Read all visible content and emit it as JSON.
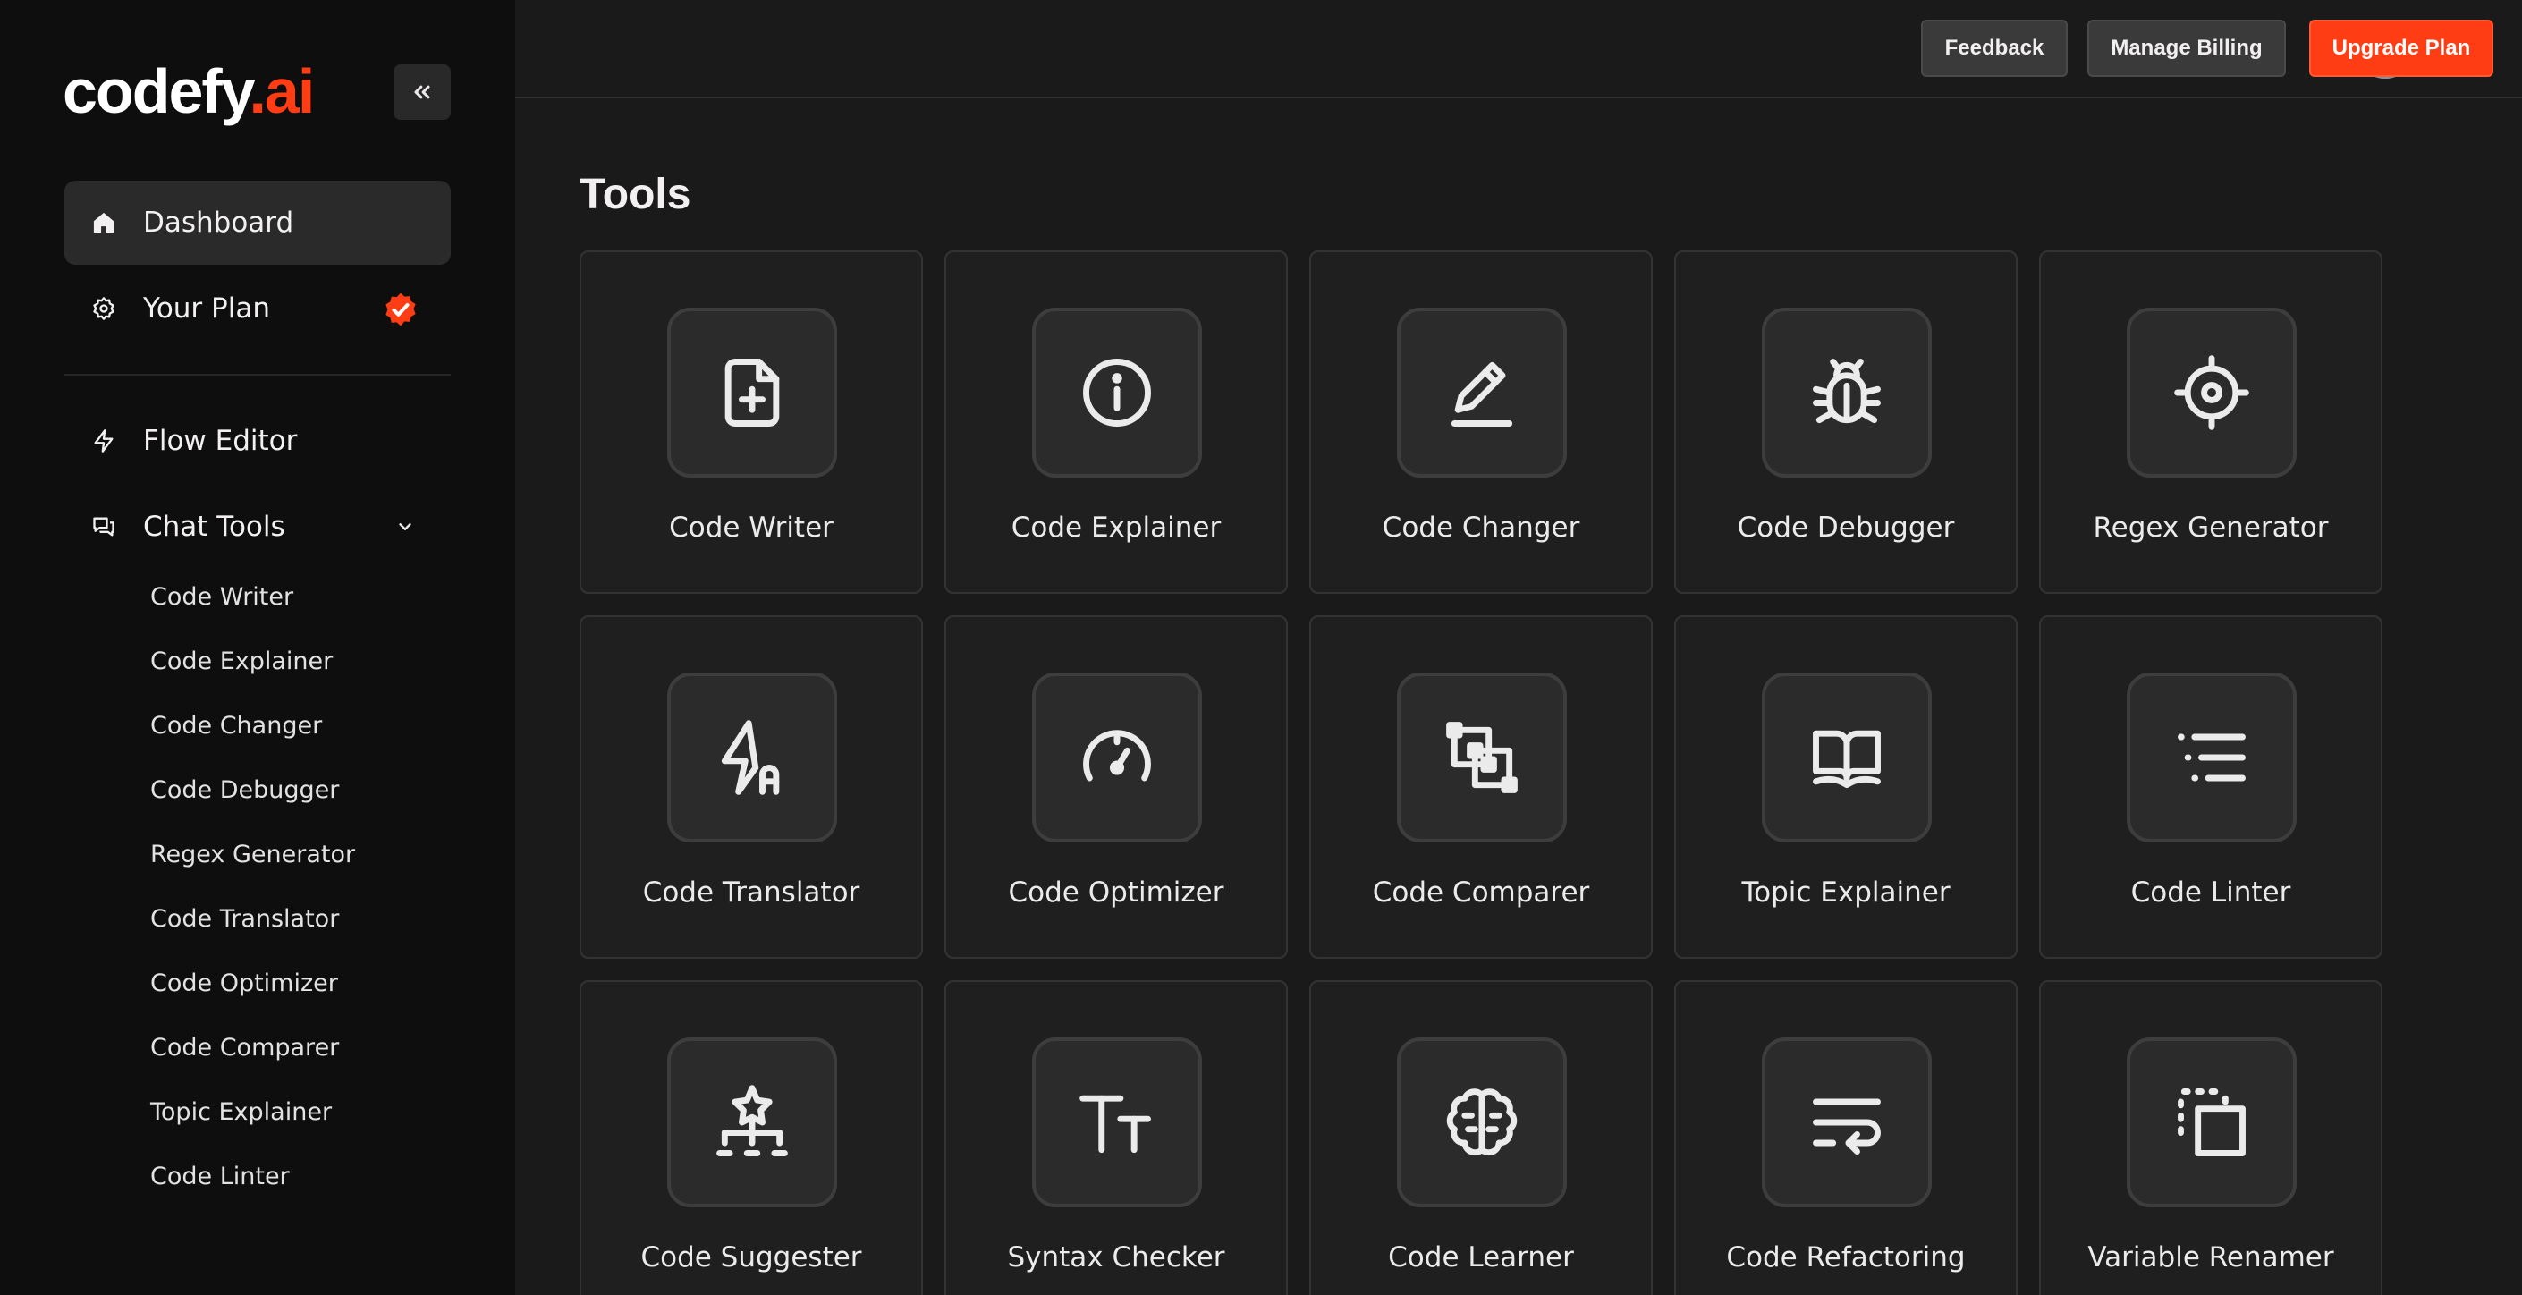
{
  "brand": {
    "name_main": "codefy",
    "name_accent": ".ai"
  },
  "sidebar": {
    "nav": [
      {
        "label": "Dashboard",
        "icon": "home-icon",
        "active": true
      },
      {
        "label": "Your Plan",
        "icon": "gear-badge-icon",
        "badge": "verified-badge-icon"
      },
      {
        "label": "Flow Editor",
        "icon": "lightning-icon"
      },
      {
        "label": "Chat Tools",
        "icon": "chat-icon",
        "expanded": true
      }
    ],
    "chat_tools": [
      "Code Writer",
      "Code Explainer",
      "Code Changer",
      "Code Debugger",
      "Regex Generator",
      "Code Translator",
      "Code Optimizer",
      "Code Comparer",
      "Topic Explainer",
      "Code Linter"
    ]
  },
  "topbar": {
    "status": "online",
    "feedback_label": "Feedback",
    "billing_label": "Manage Billing",
    "upgrade_label": "Upgrade Plan"
  },
  "main": {
    "title": "Tools",
    "tools": [
      {
        "label": "Code Writer",
        "icon": "file-plus-icon"
      },
      {
        "label": "Code Explainer",
        "icon": "info-icon"
      },
      {
        "label": "Code Changer",
        "icon": "pencil-icon"
      },
      {
        "label": "Code Debugger",
        "icon": "bug-icon"
      },
      {
        "label": "Regex Generator",
        "icon": "target-icon"
      },
      {
        "label": "Code Translator",
        "icon": "bolt-a-icon"
      },
      {
        "label": "Code Optimizer",
        "icon": "gauge-icon"
      },
      {
        "label": "Code Comparer",
        "icon": "overlap-squares-icon"
      },
      {
        "label": "Topic Explainer",
        "icon": "book-icon"
      },
      {
        "label": "Code Linter",
        "icon": "list-lines-icon"
      },
      {
        "label": "Code Suggester",
        "icon": "hierarchy-star-icon"
      },
      {
        "label": "Syntax Checker",
        "icon": "text-size-icon"
      },
      {
        "label": "Code Learner",
        "icon": "brain-icon"
      },
      {
        "label": "Code Refactoring",
        "icon": "text-wrap-icon"
      },
      {
        "label": "Variable Renamer",
        "icon": "copy-dashed-icon"
      }
    ]
  },
  "colors": {
    "accent": "#ff3d14",
    "status_online": "#1fc06a",
    "bg": "#1b1a1b",
    "sidebar_bg": "#0e0e0e"
  }
}
